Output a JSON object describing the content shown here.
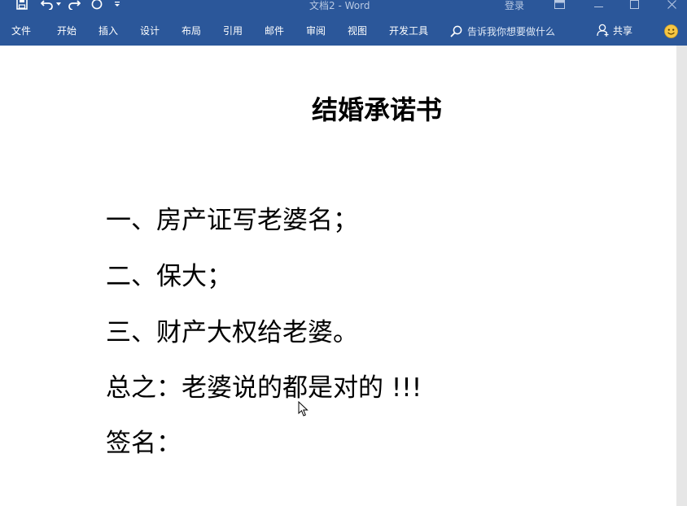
{
  "window": {
    "title": "文档2 - Word",
    "login_label": "登录"
  },
  "icons": {
    "save": "save-icon",
    "undo": "undo-icon",
    "redo": "redo-icon",
    "circle": "circle-icon",
    "customize": "customize-qat-icon",
    "restore_ribbon": "ribbon-display-icon",
    "minimize": "minimize-icon",
    "maximize": "maximize-icon",
    "close": "close-icon",
    "search": "search-icon",
    "share": "person-icon",
    "feedback": "smiley-icon",
    "cursor": "mouse-pointer-icon"
  },
  "ribbon": {
    "tabs": [
      {
        "label": "文件"
      },
      {
        "label": "开始"
      },
      {
        "label": "插入"
      },
      {
        "label": "设计"
      },
      {
        "label": "布局"
      },
      {
        "label": "引用"
      },
      {
        "label": "邮件"
      },
      {
        "label": "审阅"
      },
      {
        "label": "视图"
      },
      {
        "label": "开发工具"
      }
    ],
    "tell_me_placeholder": "告诉我你想要做什么",
    "share_label": "共享"
  },
  "colors": {
    "ribbon_blue": "#2b579a",
    "page_bg": "#ffffff",
    "scrollbar": "#e6e6e6"
  },
  "document": {
    "title": "结婚承诺书",
    "lines": [
      "一、房产证写老婆名；",
      "二、保大；",
      "三、财产大权给老婆。",
      "总之：老婆说的都是对的 !!!",
      "签名："
    ]
  }
}
